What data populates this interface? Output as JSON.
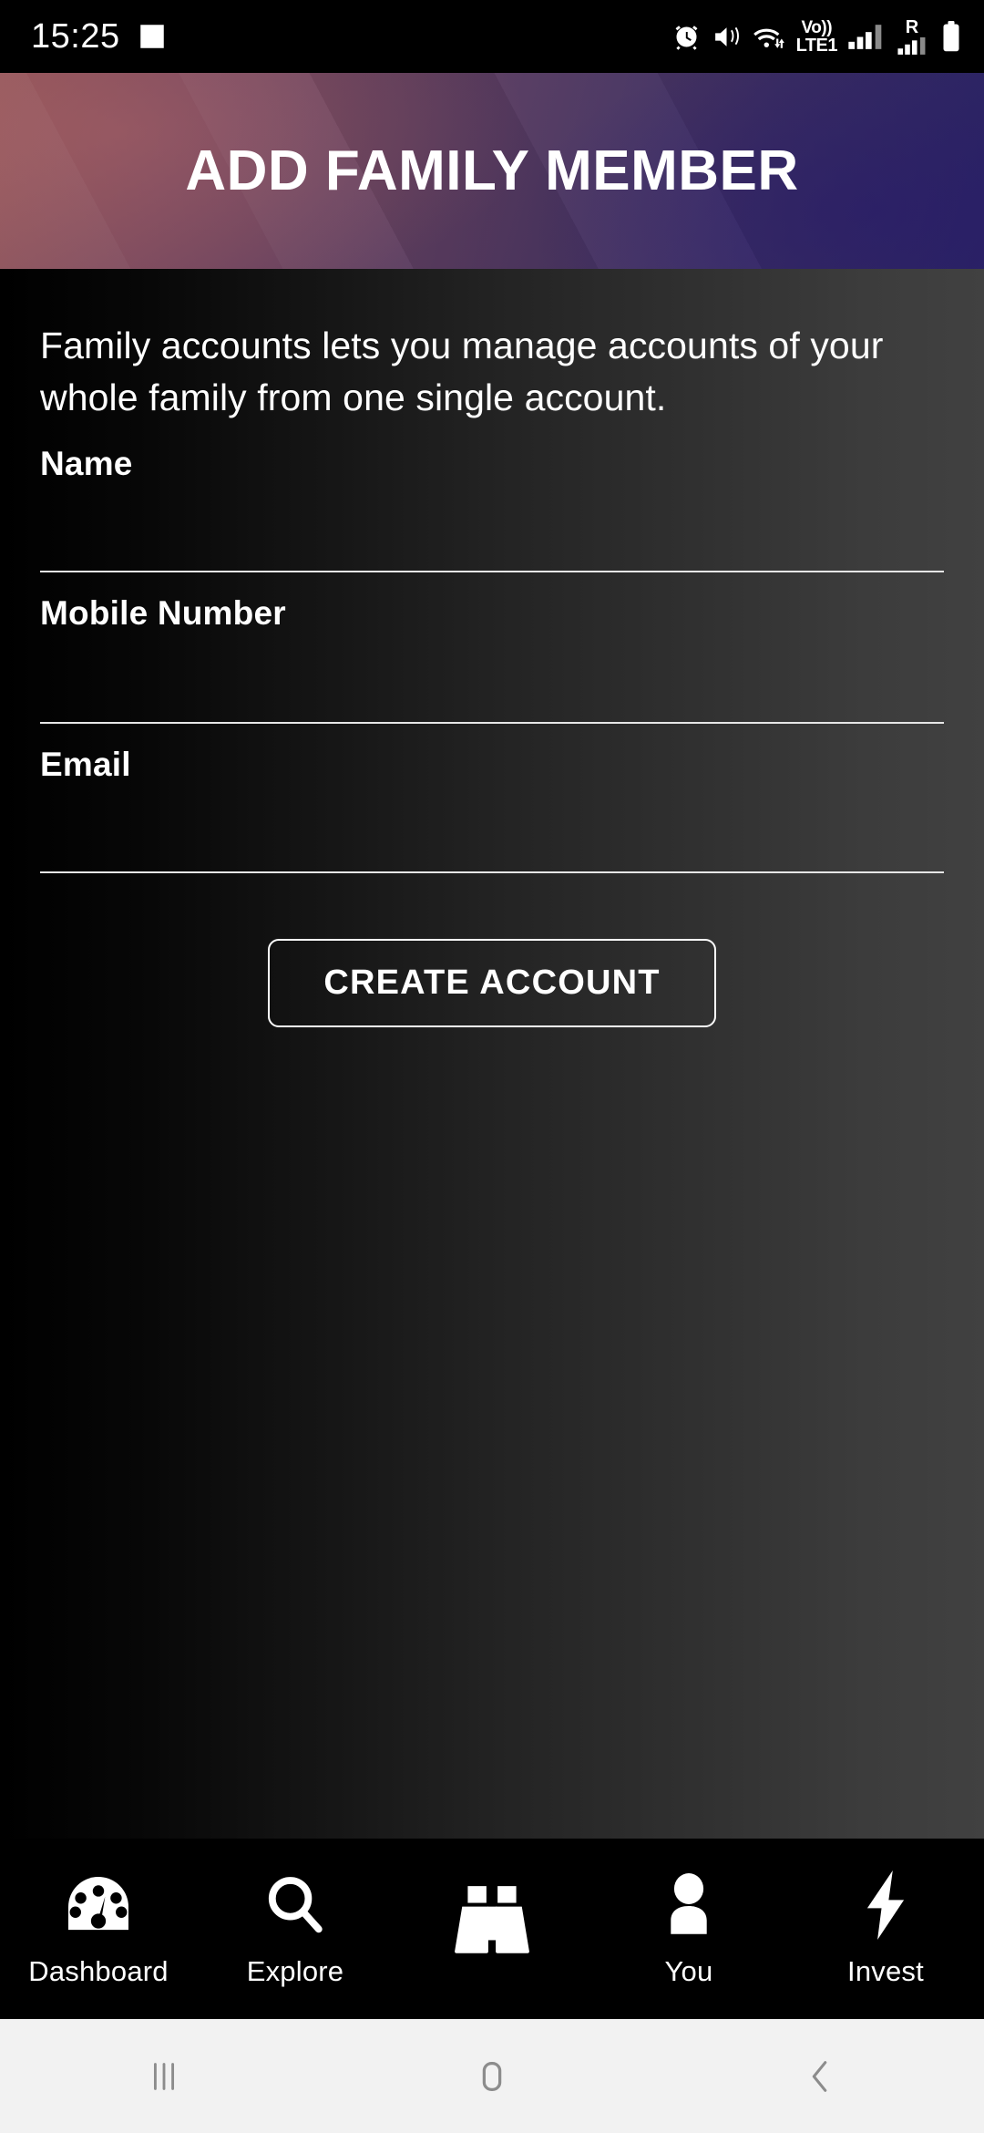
{
  "status_bar": {
    "time": "15:25",
    "icons_left": [
      "image-icon"
    ],
    "icons_right": [
      "alarm-icon",
      "mute-vibrate-icon",
      "wifi-icon",
      "volte-icon",
      "signal-bars-icon",
      "roaming-icon",
      "battery-icon"
    ],
    "volte_top": "Vo))",
    "volte_bottom": "LTE1",
    "roaming_letter": "R"
  },
  "header": {
    "title": "ADD FAMILY MEMBER",
    "gradient_start": "#8f5257",
    "gradient_end": "#2c2468"
  },
  "main": {
    "intro": "Family accounts lets you manage accounts of your whole family from one single account.",
    "fields": [
      {
        "label": "Name",
        "value": "",
        "placeholder": ""
      },
      {
        "label": "Mobile Number",
        "value": "",
        "placeholder": ""
      },
      {
        "label": "Email",
        "value": "",
        "placeholder": ""
      }
    ],
    "create_button": "CREATE ACCOUNT",
    "background_start": "#000000",
    "background_end": "#414141"
  },
  "tabbar": {
    "items": [
      {
        "label": "Dashboard",
        "icon": "speedometer-icon"
      },
      {
        "label": "Explore",
        "icon": "search-icon"
      },
      {
        "label": "",
        "icon": "binoculars-icon"
      },
      {
        "label": "You",
        "icon": "person-icon"
      },
      {
        "label": "Invest",
        "icon": "lightning-bolt-icon"
      }
    ]
  },
  "system_nav": {
    "recents": "recents-icon",
    "home": "home-icon",
    "back": "back-icon",
    "background": "#f2f2f2"
  }
}
